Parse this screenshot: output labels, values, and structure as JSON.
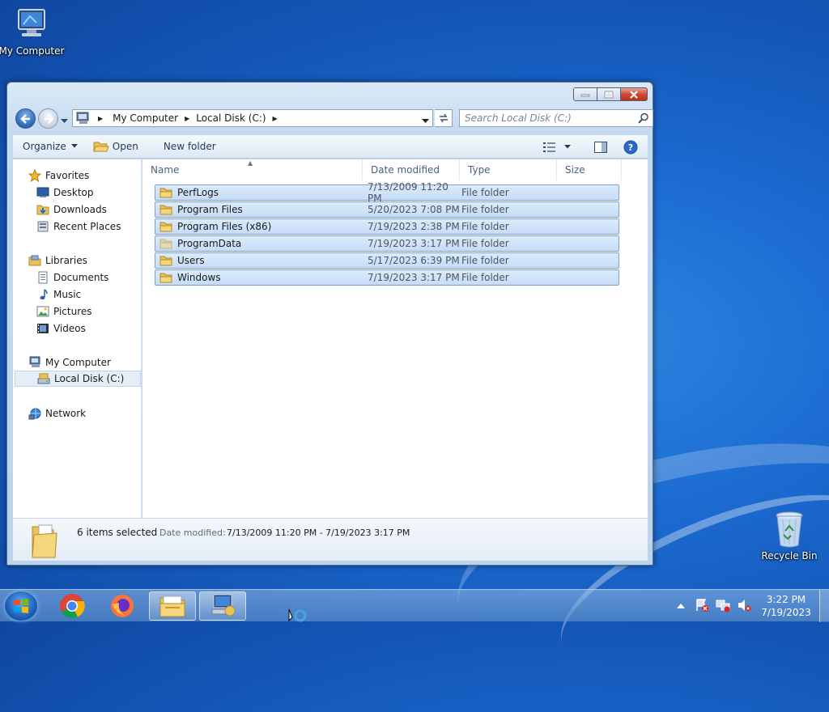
{
  "desktop": {
    "icons": [
      {
        "label": "My Computer"
      },
      {
        "label": "Recycle Bin"
      }
    ]
  },
  "window": {
    "address": {
      "crumbs": [
        "My Computer",
        "Local Disk (C:)"
      ]
    },
    "search": {
      "placeholder": "Search Local Disk (C:)"
    },
    "toolbar": {
      "organize": "Organize",
      "open": "Open",
      "new_folder": "New folder"
    },
    "nav": {
      "favorites": "Favorites",
      "desktop": "Desktop",
      "downloads": "Downloads",
      "recent": "Recent Places",
      "libraries": "Libraries",
      "documents": "Documents",
      "music": "Music",
      "pictures": "Pictures",
      "videos": "Videos",
      "computer": "My Computer",
      "local_disk": "Local Disk (C:)",
      "network": "Network"
    },
    "columns": {
      "name": "Name",
      "date": "Date modified",
      "type": "Type",
      "size": "Size"
    },
    "files": [
      {
        "name": "PerfLogs",
        "date": "7/13/2009 11:20 PM",
        "type": "File folder"
      },
      {
        "name": "Program Files",
        "date": "5/20/2023 7:08 PM",
        "type": "File folder"
      },
      {
        "name": "Program Files (x86)",
        "date": "7/19/2023 2:38 PM",
        "type": "File folder"
      },
      {
        "name": "ProgramData",
        "date": "7/19/2023 3:17 PM",
        "type": "File folder"
      },
      {
        "name": "Users",
        "date": "5/17/2023 6:39 PM",
        "type": "File folder"
      },
      {
        "name": "Windows",
        "date": "7/19/2023 3:17 PM",
        "type": "File folder"
      }
    ],
    "details": {
      "count": "6 items selected",
      "date_label": "Date modified:",
      "date_value": "7/13/2009 11:20 PM - 7/19/2023 3:17 PM"
    }
  },
  "taskbar": {
    "time": "3:22 PM",
    "date": "7/19/2023"
  },
  "colors": {
    "folder": "#e8c35a",
    "selection": "#cde2f9",
    "accent": "#1e395b"
  }
}
